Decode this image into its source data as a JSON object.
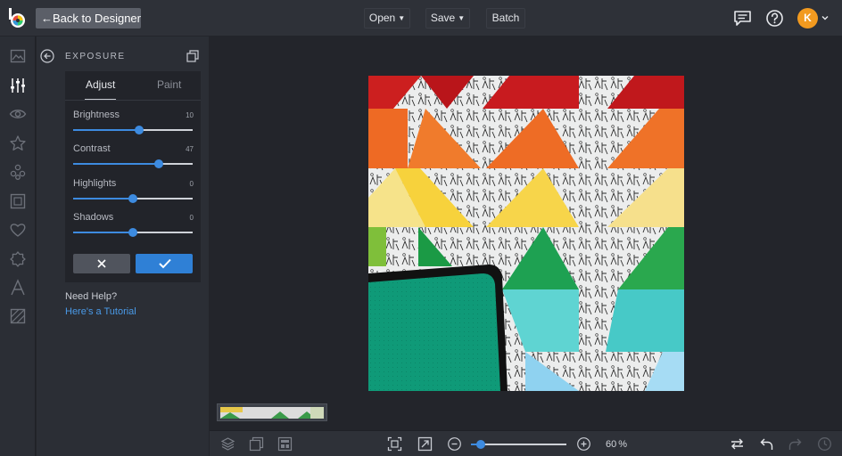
{
  "header": {
    "back_label": "←Back to Designer",
    "menus": [
      {
        "label": "Open"
      },
      {
        "label": "Save"
      },
      {
        "label": "Batch"
      }
    ],
    "avatar_initial": "K"
  },
  "rail": {
    "icons": [
      "image-icon",
      "sliders-icon",
      "eye-icon",
      "star-icon",
      "shapes-icon",
      "frame-icon",
      "heart-icon",
      "texture-icon",
      "text-icon",
      "graphics-icon"
    ],
    "active": "sliders-icon"
  },
  "panel": {
    "title": "EXPOSURE",
    "tabs": [
      {
        "label": "Adjust",
        "active": true
      },
      {
        "label": "Paint",
        "active": false
      }
    ],
    "sliders": [
      {
        "label": "Brightness",
        "value": "10",
        "position": 0.55
      },
      {
        "label": "Contrast",
        "value": "47",
        "position": 0.72
      },
      {
        "label": "Highlights",
        "value": "0",
        "position": 0.5
      },
      {
        "label": "Shadows",
        "value": "0",
        "position": 0.5
      }
    ],
    "help_title": "Need Help?",
    "help_link": "Here's a Tutorial"
  },
  "zoom": {
    "value": "60",
    "unit": "%",
    "position": 0.1
  },
  "colors": {
    "accent": "#2f80d6",
    "avatar": "#f29a1f"
  }
}
